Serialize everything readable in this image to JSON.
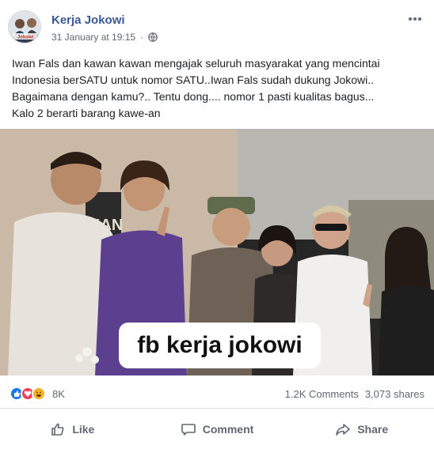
{
  "post": {
    "author": "Kerja Jokowi",
    "timestamp": "31 January at 19:15",
    "privacy_icon": "globe-icon",
    "text_lines": [
      "Iwan Fals dan kawan kawan mengajak seluruh masyarakat yang mencintai",
      "Indonesia berSATU untuk nomor SATU..Iwan Fals sudah dukung Jokowi..",
      "Bagaimana dengan kamu?.. Tentu dong.... nomor 1 pasti kualitas bagus...",
      "Kalo 2 berarti barang kawe-an"
    ],
    "avatar_text": "Jokowi",
    "image_caption": "fb kerja jokowi",
    "image_signs": [
      "KAN"
    ]
  },
  "stats": {
    "reaction_count": "8K",
    "comments": "1.2K Comments",
    "shares": "3,073 shares"
  },
  "actions": {
    "like": "Like",
    "comment": "Comment",
    "share": "Share"
  },
  "colors": {
    "author_link": "#385898",
    "like_blue": "#1877f2",
    "love_red": "#f33e58",
    "haha_yellow": "#f7b125",
    "secondary_text": "#606770"
  }
}
